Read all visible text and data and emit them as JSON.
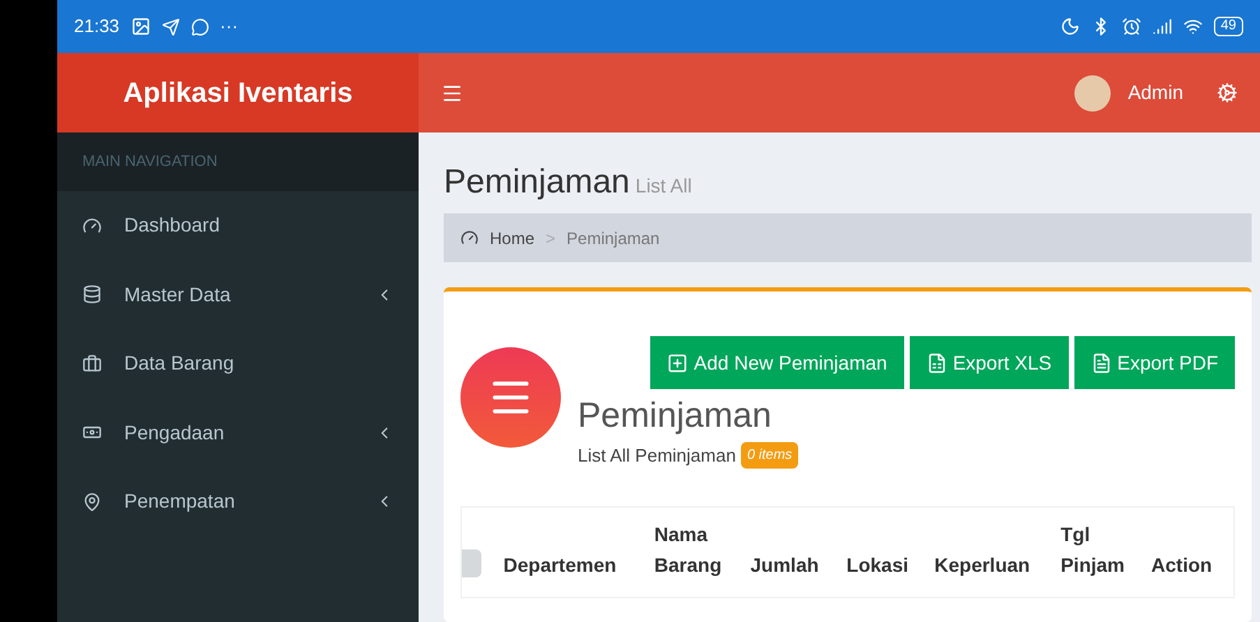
{
  "status_bar": {
    "time": "21:33",
    "more": "···",
    "battery": "49"
  },
  "header": {
    "brand": "Aplikasi Iventaris",
    "user": "Admin"
  },
  "sidebar": {
    "heading": "MAIN NAVIGATION",
    "items": [
      {
        "label": "Dashboard",
        "has_submenu": false
      },
      {
        "label": "Master Data",
        "has_submenu": true
      },
      {
        "label": "Data Barang",
        "has_submenu": false
      },
      {
        "label": "Pengadaan",
        "has_submenu": true
      },
      {
        "label": "Penempatan",
        "has_submenu": true
      }
    ]
  },
  "page": {
    "title": "Peminjaman",
    "subtitle": "List All"
  },
  "breadcrumb": [
    {
      "label": "Home"
    },
    {
      "label": "Peminjaman"
    }
  ],
  "breadcrumb_separator": ">",
  "box": {
    "buttons": [
      {
        "label": "Add New Peminjaman"
      },
      {
        "label": "Export XLS"
      },
      {
        "label": "Export PDF"
      }
    ],
    "title": "Peminjaman",
    "subtitle": "List All Peminjaman",
    "badge": "0 items"
  },
  "table": {
    "columns": [
      "Departemen",
      "Nama Barang",
      "Jumlah",
      "Lokasi",
      "Keperluan",
      "Tgl Pinjam",
      "Action"
    ]
  }
}
